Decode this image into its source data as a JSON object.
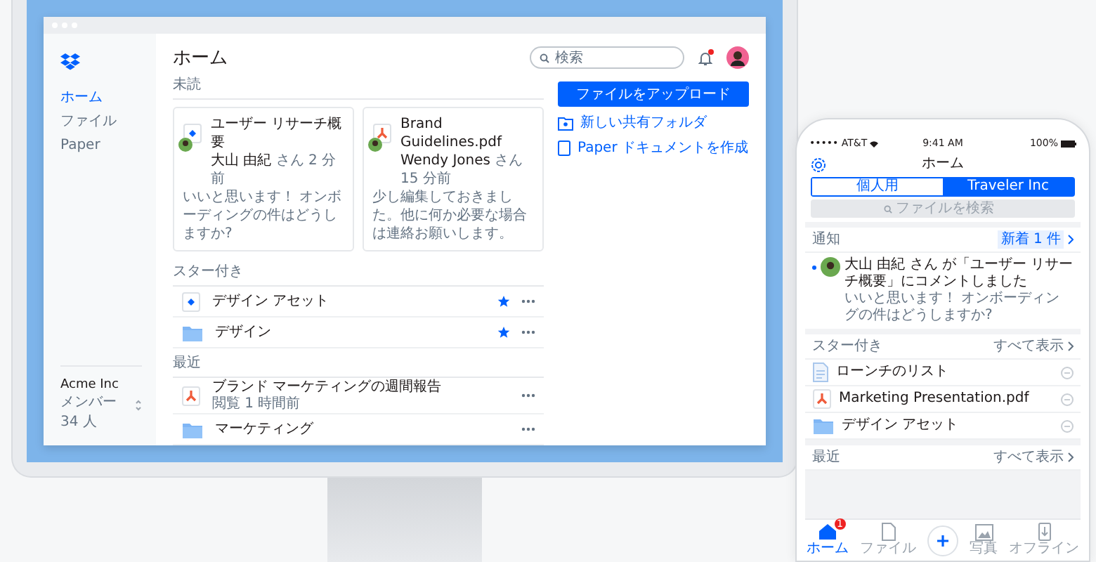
{
  "desktop": {
    "sidebar": {
      "items": [
        {
          "label": "ホーム",
          "selected": true
        },
        {
          "label": "ファイル",
          "selected": false
        },
        {
          "label": "Paper",
          "selected": false
        }
      ],
      "team": {
        "name": "Acme Inc",
        "members": "メンバー 34 人"
      }
    },
    "header": {
      "title": "ホーム",
      "search": {
        "placeholder": "検索"
      },
      "notification_unread": true
    },
    "sections": [
      {
        "title": "未読",
        "kind": "cards",
        "items": [
          {
            "kind": "paper",
            "title": "ユーザー リサーチ概要",
            "meta": "**大山 由紀** さん 2 分前",
            "comment": "いいと思います！ オンボーディングの件はどうしますか?"
          },
          {
            "kind": "pdf",
            "title": "Brand Guidelines.pdf",
            "meta": "**Wendy Jones** さん 15 分前",
            "comment": "少し編集しておきました。他に何か必要な場合は連絡お願いします。"
          }
        ]
      },
      {
        "title": "スター付き",
        "kind": "rows",
        "items": [
          {
            "kind": "paper",
            "name": "デザイン アセット",
            "starred": true
          },
          {
            "kind": "folder",
            "name": "デザイン",
            "starred": true
          }
        ]
      },
      {
        "title": "最近",
        "kind": "rows",
        "items": [
          {
            "kind": "pdf",
            "name": "ブランド マーケティングの週間報告",
            "detail": "閲覧 1 時間前",
            "starred": false
          },
          {
            "kind": "folder",
            "name": "マーケティング",
            "starred": false
          }
        ]
      }
    ],
    "actions": [
      {
        "kind": "primary",
        "label": "ファイルをアップロード"
      },
      {
        "kind": "shared-folder",
        "label": "新しい共有フォルダ"
      },
      {
        "kind": "document",
        "label": "Paper ドキュメントを作成"
      }
    ]
  },
  "phone": {
    "status_bar": {
      "carrier": "••••• AT&T",
      "time": "9:41 AM",
      "battery": "100%"
    },
    "title": "ホーム",
    "segments": [
      {
        "label": "個人用",
        "selected": false
      },
      {
        "label": "Traveler Inc",
        "selected": true
      }
    ],
    "search": {
      "placeholder": "ファイルを検索"
    },
    "notifications": {
      "title": "通知",
      "badge": "新着 1 件",
      "items": [
        {
          "unread": true,
          "text": "大山 由紀 さん が「ユーザー リサーチ概要」にコメントしました",
          "comment": "いいと思います！ オンボーディングの件はどうしますか?"
        }
      ]
    },
    "starred": {
      "title": "スター付き",
      "link": "すべて表示",
      "items": [
        {
          "kind": "document",
          "name": "ローンチのリスト"
        },
        {
          "kind": "pdf",
          "name": "Marketing Presentation.pdf"
        },
        {
          "kind": "folder",
          "name": "デザイン アセット"
        }
      ]
    },
    "recent": {
      "title": "最近",
      "link": "すべて表示"
    },
    "tab_bar": [
      {
        "kind": "home",
        "label": "ホーム",
        "selected": true,
        "badge": "1"
      },
      {
        "kind": "files",
        "label": "ファイル",
        "selected": false
      },
      {
        "kind": "add",
        "selected": false
      },
      {
        "kind": "photos",
        "label": "写真",
        "selected": false
      },
      {
        "kind": "offline",
        "label": "オフライン",
        "selected": false
      }
    ]
  }
}
